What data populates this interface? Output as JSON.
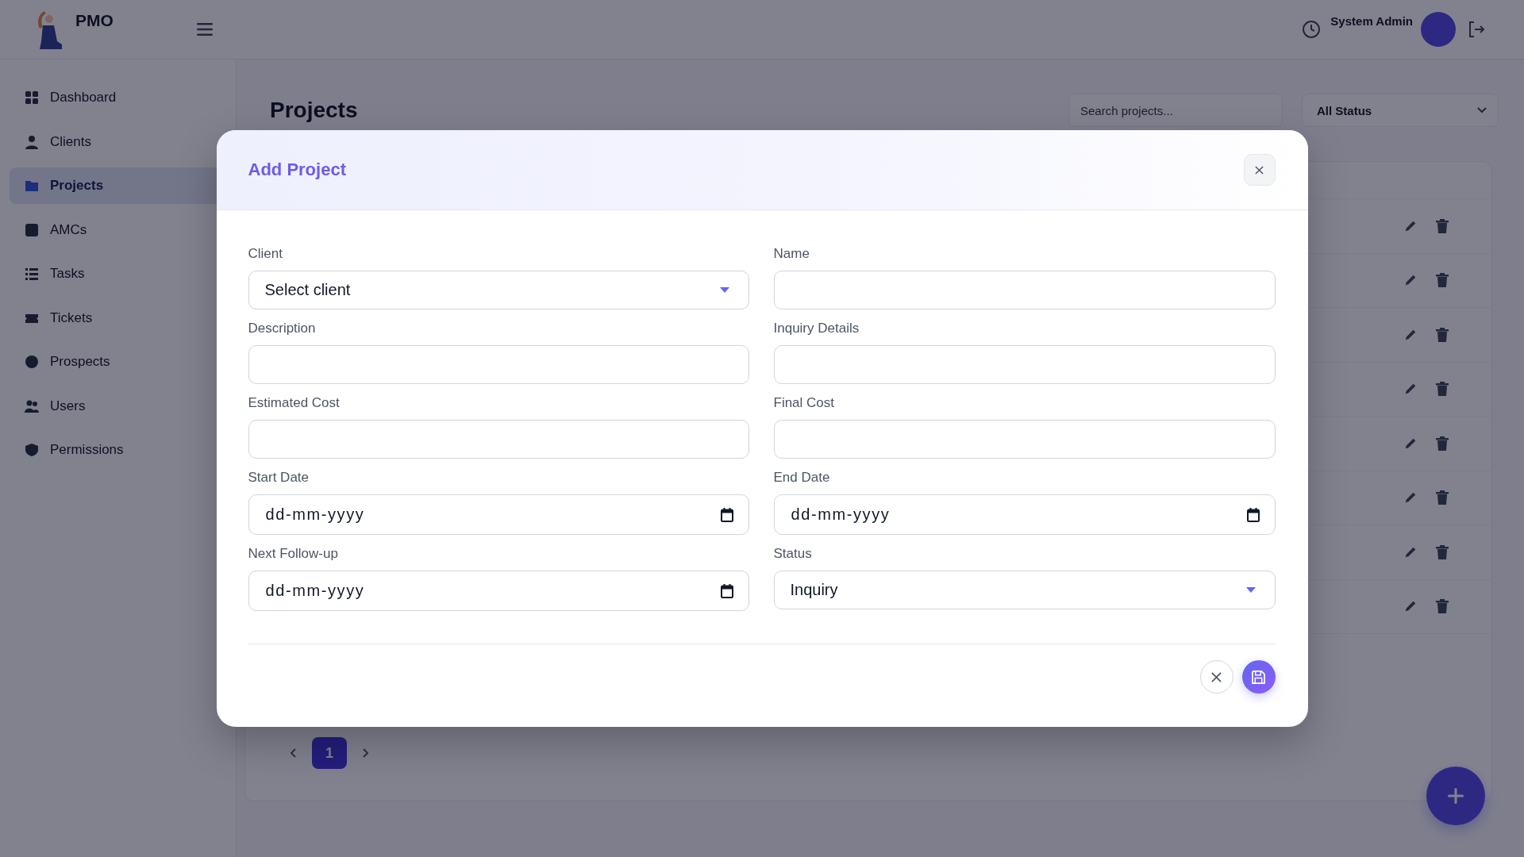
{
  "header": {
    "brand": "PMO",
    "user_name": "System Admin"
  },
  "sidebar": {
    "items": [
      {
        "label": "Dashboard",
        "selected": false
      },
      {
        "label": "Clients",
        "selected": false
      },
      {
        "label": "Projects",
        "selected": true
      },
      {
        "label": "AMCs",
        "selected": false
      },
      {
        "label": "Tasks",
        "selected": false
      },
      {
        "label": "Tickets",
        "selected": false
      },
      {
        "label": "Prospects",
        "selected": false
      },
      {
        "label": "Users",
        "selected": false
      },
      {
        "label": "Permissions",
        "selected": false
      }
    ]
  },
  "page": {
    "title": "Projects",
    "search": {
      "placeholder": "Search projects..."
    },
    "status_filter": {
      "value": "All Status"
    }
  },
  "pagination": {
    "pages": [
      {
        "label": "1",
        "selected": true
      }
    ]
  },
  "modal": {
    "title": "Add Project",
    "fields": [
      {
        "label": "Client",
        "kind": "select",
        "value": "Select client"
      },
      {
        "label": "Name",
        "kind": "text"
      },
      {
        "label": "Description",
        "kind": "text"
      },
      {
        "label": "Inquiry Details",
        "kind": "text"
      },
      {
        "label": "Estimated Cost",
        "kind": "text"
      },
      {
        "label": "Final Cost",
        "kind": "text"
      },
      {
        "label": "Start Date",
        "kind": "date",
        "placeholder": "dd-mm-yyyy"
      },
      {
        "label": "End Date",
        "kind": "date",
        "placeholder": "dd-mm-yyyy"
      },
      {
        "label": "Next Follow-up",
        "kind": "date",
        "placeholder": "dd-mm-yyyy"
      },
      {
        "label": "Status",
        "kind": "select",
        "value": "Inquiry"
      }
    ]
  }
}
